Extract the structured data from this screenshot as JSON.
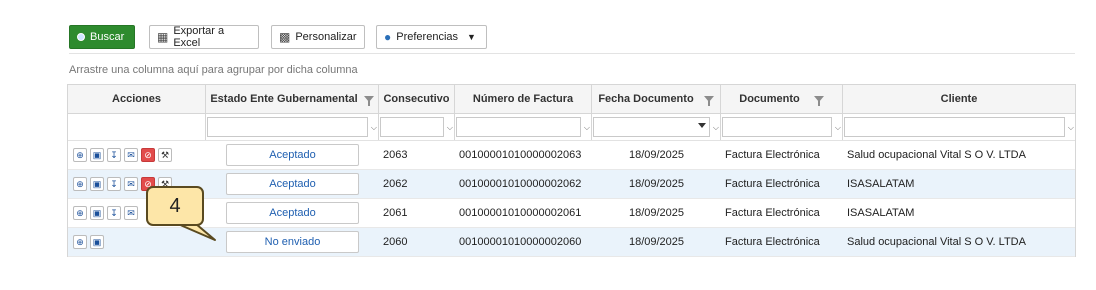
{
  "toolbar": {
    "search_label": "Buscar",
    "export_label": "Exportar a Excel",
    "customize_label": "Personalizar",
    "preferences_label": "Preferencias",
    "primary_color": "#2e8b2e"
  },
  "grid": {
    "group_hint": "Arrastre una columna aquí para agrupar por dicha columna",
    "columns": [
      "Acciones",
      "Estado Ente Gubernamental",
      "Consecutivo",
      "Número de Factura",
      "Fecha Documento",
      "Documento",
      "Cliente"
    ],
    "rows": [
      {
        "status": "Aceptado",
        "consecutivo": "2063",
        "factura": "0010000101000000206​3",
        "fecha": "18/09/2025",
        "documento": "Factura Electrónica",
        "cliente": "Salud ocupacional Vital S O V. LTDA"
      },
      {
        "status": "Aceptado",
        "consecutivo": "2062",
        "factura": "00100001010000002062",
        "fecha": "18/09/2025",
        "documento": "Factura Electrónica",
        "cliente": "ISASALATAM"
      },
      {
        "status": "Aceptado",
        "consecutivo": "2061",
        "factura": "00100001010000002061",
        "fecha": "18/09/2025",
        "documento": "Factura Electrónica",
        "cliente": "ISASALATAM"
      },
      {
        "status": "No enviado",
        "consecutivo": "2060",
        "factura": "00100001010000002060",
        "fecha": "18/09/2025",
        "documento": "Factura Electrónica",
        "cliente": "Salud ocupacional Vital S O V. LTDA"
      }
    ],
    "action_icons": [
      "zoom-icon",
      "save-icon",
      "download-icon",
      "email-icon",
      "cancel-icon",
      "wrench-icon"
    ]
  },
  "callout": {
    "number": "4",
    "color": "#fde6a8"
  }
}
